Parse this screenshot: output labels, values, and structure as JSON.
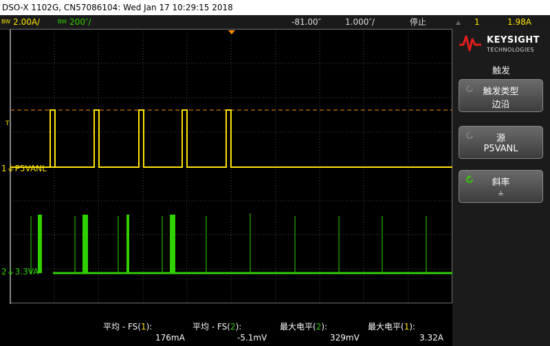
{
  "window": {
    "title": "DSO-X 1102G, CN57086104: Wed Jan 17 10:29:15 2018"
  },
  "status": {
    "ch1_bw": "BW",
    "ch1_scale": "2.00A/",
    "ch2_bw": "BW",
    "ch2_scale": "200″/",
    "time_offset": "-81.00″",
    "time_scale": "1.000″/",
    "run_state": "停止",
    "trig_slope_icon": "⫨",
    "trig_source": "1",
    "trig_level": "1.98A"
  },
  "channels": {
    "ch1": {
      "number": "1",
      "label": "P5VANL",
      "color": "#ffe600"
    },
    "ch2": {
      "number": "2",
      "label": "3.3VA",
      "color": "#30d000"
    }
  },
  "markers": {
    "trigger_level_marker": "T"
  },
  "trigger_panel": {
    "brand": "KEYSIGHT",
    "brand_sub": "TECHNOLOGIES",
    "title": "触发",
    "softkeys": [
      {
        "label": "触发类型",
        "value": "边沿"
      },
      {
        "label": "源",
        "value": "P5VANL"
      },
      {
        "label": "斜率",
        "value": "⫨"
      }
    ]
  },
  "measurements": [
    {
      "label_prefix": "平均 - FS(",
      "ch": "1",
      "suffix": "):",
      "value": "176mA"
    },
    {
      "label_prefix": "平均 - FS(",
      "ch": "2",
      "suffix": "):",
      "value": "-5.1mV"
    },
    {
      "label_prefix": "最大电平(",
      "ch": "2",
      "suffix": "):",
      "value": "329mV"
    },
    {
      "label_prefix": "最大电平(",
      "ch": "1",
      "suffix": "):",
      "value": "3.32A"
    }
  ],
  "colors": {
    "accent": "#ff8c00",
    "ch1": "#ffe600",
    "ch2": "#30d000",
    "logo": "#e41d1d"
  },
  "icons": {
    "logo": "keysight-wave-logo",
    "softkey": "rotate-knob-icon"
  }
}
